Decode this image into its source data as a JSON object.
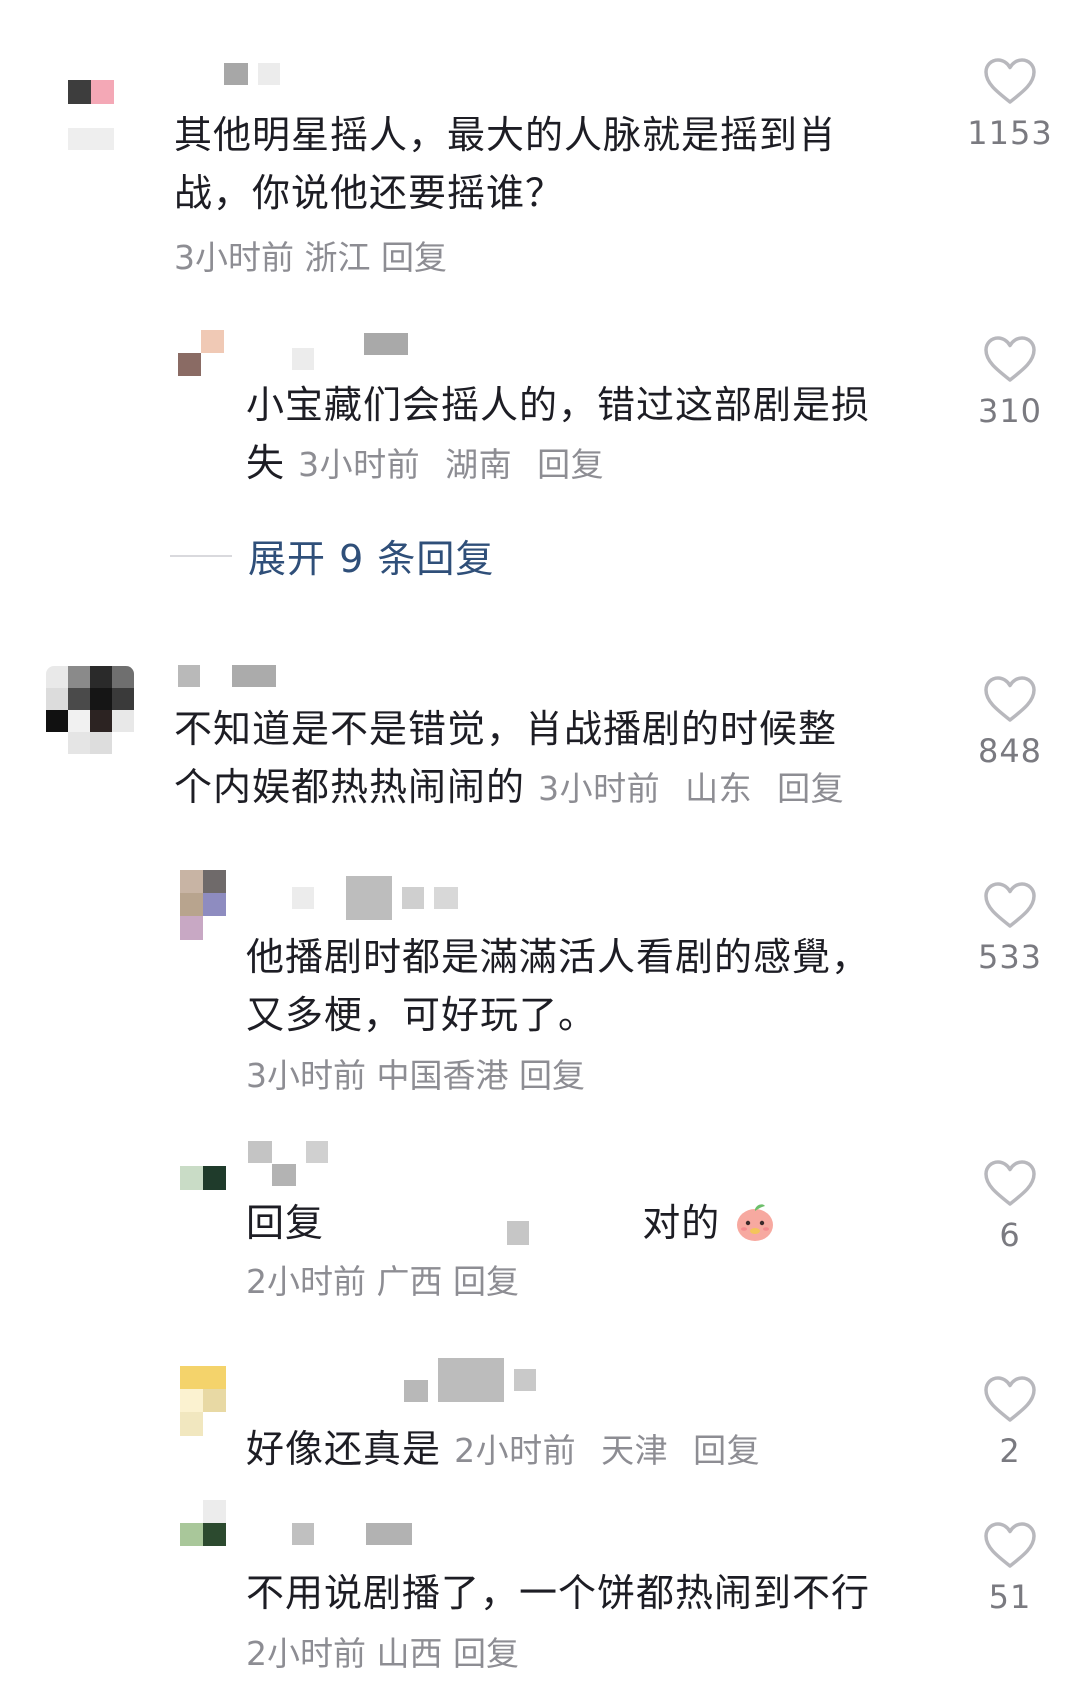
{
  "comments": [
    {
      "text": "其他明星摇人，最大的人脉就是摇到肖战，你说他还要摇谁？",
      "line1": "其他明星摇人，最大的人脉就是摇到肖",
      "line2": "战，你说他还要摇谁？",
      "time": "3小时前",
      "location": "浙江",
      "reply_label": "回复",
      "likes": "1153"
    },
    {
      "text": "小宝藏们会摇人的，错过这部剧是损失",
      "line1": "小宝藏们会摇人的，错过这部剧是损",
      "line2": "失",
      "time": "3小时前",
      "location": "湖南",
      "reply_label": "回复",
      "likes": "310"
    },
    {
      "text": "不知道是不是错觉，肖战播剧的时候整个内娱都热热闹闹的",
      "line1": "不知道是不是错觉，肖战播剧的时候整",
      "line2": "个内娱都热热闹闹的",
      "time": "3小时前",
      "location": "山东",
      "reply_label": "回复",
      "likes": "848"
    },
    {
      "text": "他播剧时都是滿滿活人看剧的感覺，又多梗，可好玩了。",
      "line1": "他播剧时都是滿滿活人看剧的感覺，",
      "line2": "又多梗，可好玩了。",
      "time": "3小时前",
      "location": "中国香港",
      "reply_label": "回复",
      "likes": "533"
    },
    {
      "prefix": "回复",
      "text": "对的",
      "time": "2小时前",
      "location": "广西",
      "reply_label": "回复",
      "likes": "6"
    },
    {
      "text": "好像还真是",
      "time": "2小时前",
      "location": "天津",
      "reply_label": "回复",
      "likes": "2"
    },
    {
      "text": "不用说剧播了，一个饼都热闹到不行",
      "time": "2小时前",
      "location": "山西",
      "reply_label": "回复",
      "likes": "51"
    }
  ],
  "expand_replies": "展开 9 条回复",
  "icons": {
    "like": "heart-outline-icon",
    "emoji": "peach-face-emoji"
  },
  "colors": {
    "text": "#1d1d24",
    "meta": "#8d8d93",
    "link": "#2f4f79",
    "heart_stroke": "#b8b8bd"
  }
}
